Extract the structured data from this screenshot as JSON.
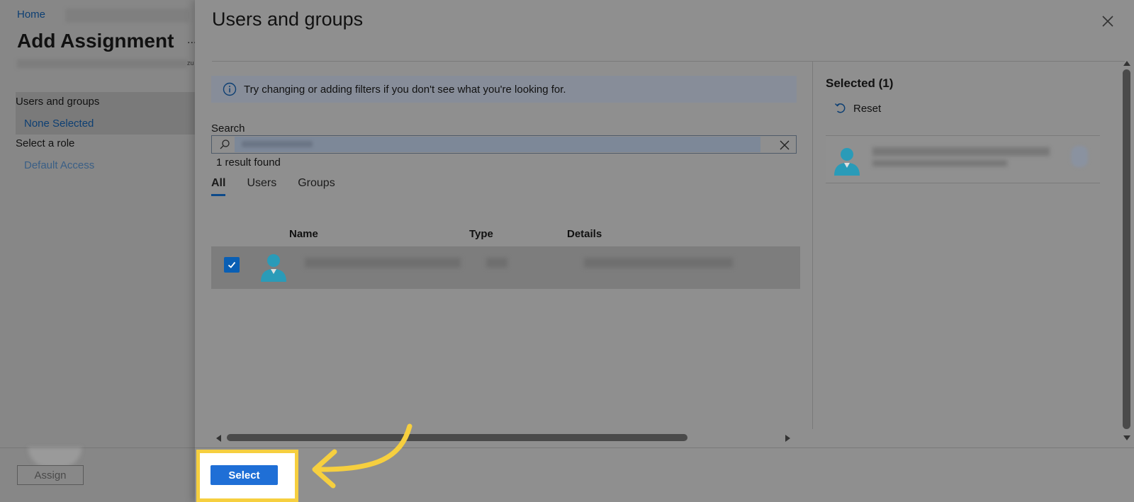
{
  "background_blade": {
    "breadcrumb": "Home",
    "title": "Add Assignment",
    "more": "...",
    "side_text": "zu",
    "sections": [
      {
        "label": "Users and groups",
        "value": "None Selected"
      },
      {
        "label": "Select a role",
        "value": "Default Access"
      }
    ],
    "assign_label": "Assign"
  },
  "dialog": {
    "title": "Users and groups",
    "info": "Try changing or adding filters if you don't see what you're looking for.",
    "search": {
      "label": "Search",
      "value": "",
      "placeholder": ""
    },
    "result_count": "1 result found",
    "tabs": [
      {
        "label": "All",
        "active": true
      },
      {
        "label": "Users",
        "active": false
      },
      {
        "label": "Groups",
        "active": false
      }
    ],
    "table": {
      "columns": [
        "Name",
        "Type",
        "Details"
      ],
      "rows": [
        {
          "checked": true
        }
      ]
    },
    "selected": {
      "title": "Selected (1)",
      "reset_label": "Reset"
    },
    "select_label": "Select"
  },
  "colors": {
    "accent": "#1f6fd6",
    "highlight": "#f6cf3f",
    "avatar": "#2a9bb8",
    "link": "#0d3f73"
  },
  "icons": [
    "close-icon",
    "info-icon",
    "search-icon",
    "clear-icon",
    "check-icon",
    "user-avatar-icon",
    "reset-icon",
    "curved-arrow-icon"
  ]
}
